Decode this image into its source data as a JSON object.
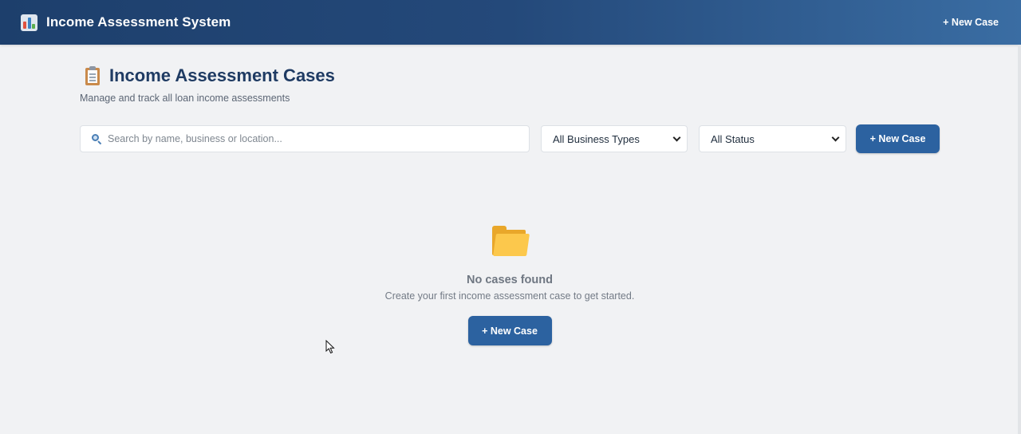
{
  "header": {
    "brand_icon": "bar-chart-icon",
    "title": "Income Assessment System",
    "new_case_label": "+ New Case"
  },
  "page": {
    "title_icon": "clipboard-icon",
    "title": "Income Assessment Cases",
    "subtitle": "Manage and track all loan income assessments"
  },
  "filters": {
    "search_placeholder": "Search by name, business or location...",
    "business_type_selected": "All Business Types",
    "status_selected": "All Status",
    "new_case_label": "+ New Case"
  },
  "empty_state": {
    "icon": "folder-icon",
    "title": "No cases found",
    "message": "Create your first income assessment case to get started.",
    "new_case_label": "+ New Case"
  },
  "colors": {
    "header_start": "#1d3f6c",
    "header_end": "#3a6da3",
    "primary_button": "#2c62a0",
    "title_text": "#1f3b63",
    "background": "#f1f2f4"
  }
}
